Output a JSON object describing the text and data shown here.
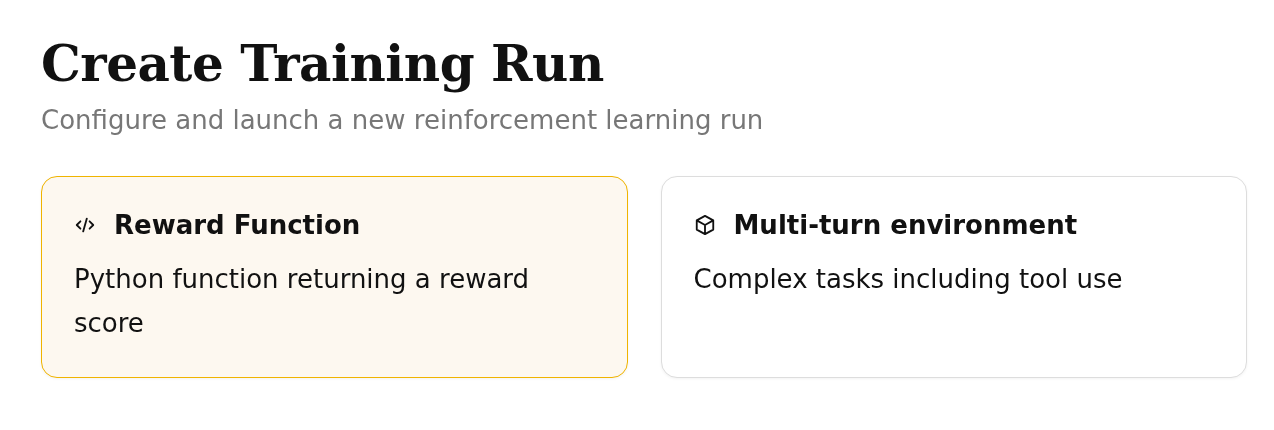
{
  "header": {
    "title": "Create Training Run",
    "subtitle": "Configure and launch a new reinforcement learning run"
  },
  "options": [
    {
      "kind": "code",
      "title": "Reward Function",
      "description": "Python function returning a reward score",
      "selected": true
    },
    {
      "kind": "cube",
      "title": "Multi-turn environment",
      "description": "Complex tasks including tool use",
      "selected": false
    }
  ]
}
